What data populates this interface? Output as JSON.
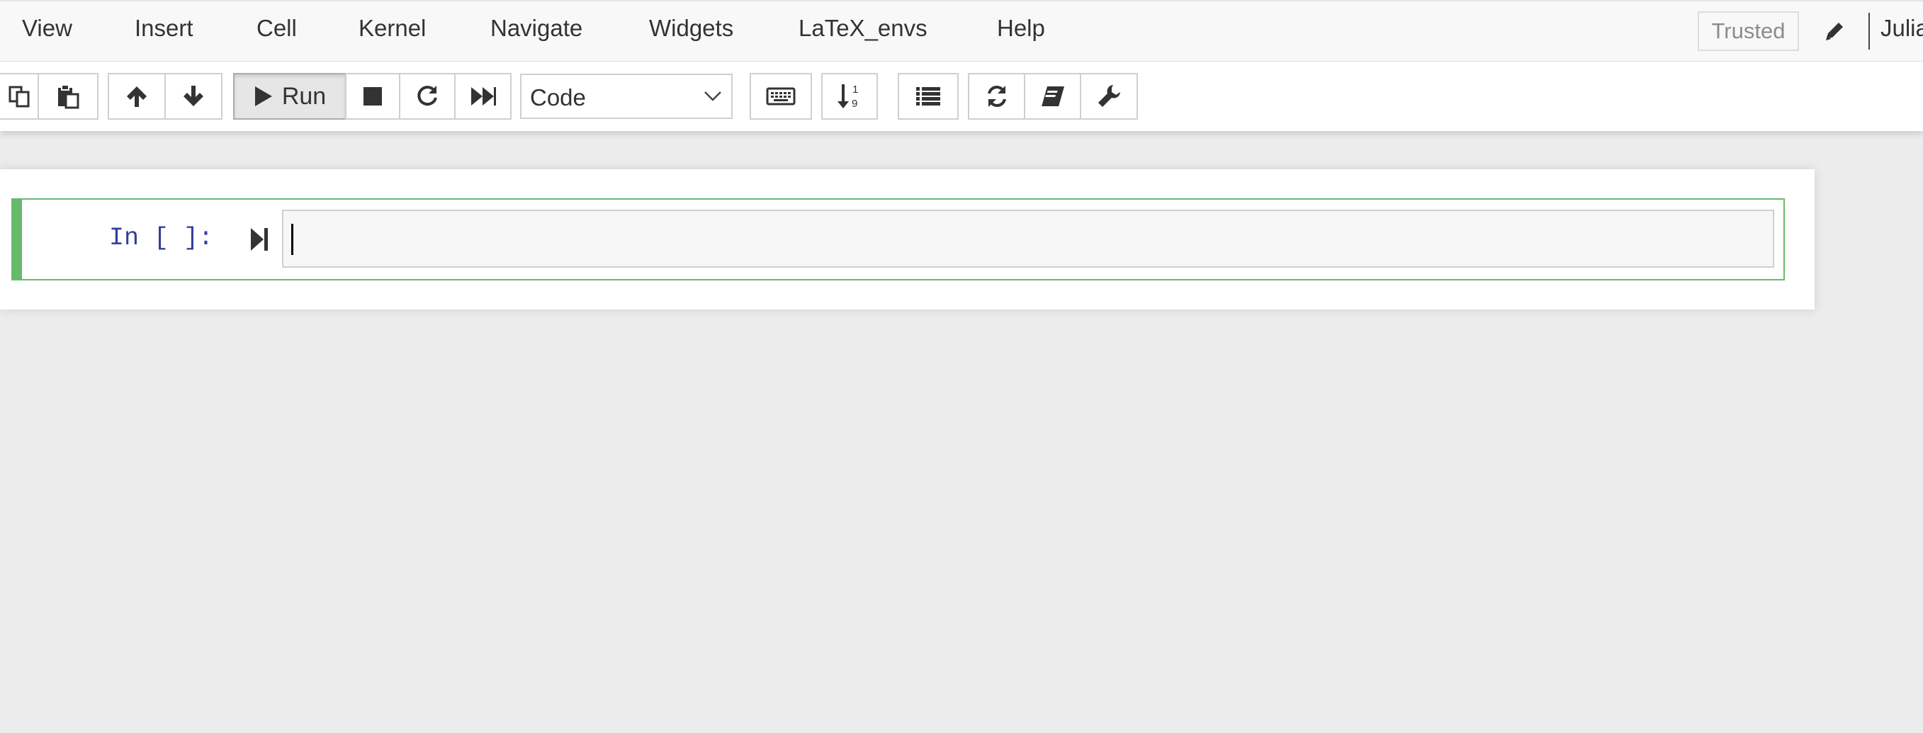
{
  "menubar": {
    "items": [
      "View",
      "Insert",
      "Cell",
      "Kernel",
      "Navigate",
      "Widgets",
      "LaTeX_envs",
      "Help"
    ],
    "trusted_label": "Trusted",
    "kernel_name": "Julia"
  },
  "toolbar": {
    "run_label": "Run",
    "cell_type": "Code",
    "icons": [
      "copy-icon",
      "paste-icon",
      "arrow-up-icon",
      "arrow-down-icon",
      "play-icon",
      "stop-icon",
      "restart-icon",
      "fast-forward-icon",
      "keyboard-icon",
      "sort-numeric-icon",
      "list-icon",
      "refresh-icon",
      "book-icon",
      "wrench-icon"
    ]
  },
  "cell": {
    "prompt": "In [ ]:",
    "source": ""
  },
  "colors": {
    "accent_green": "#66bb6a",
    "prompt_blue": "#303f9f",
    "page_bg": "#ececec"
  }
}
